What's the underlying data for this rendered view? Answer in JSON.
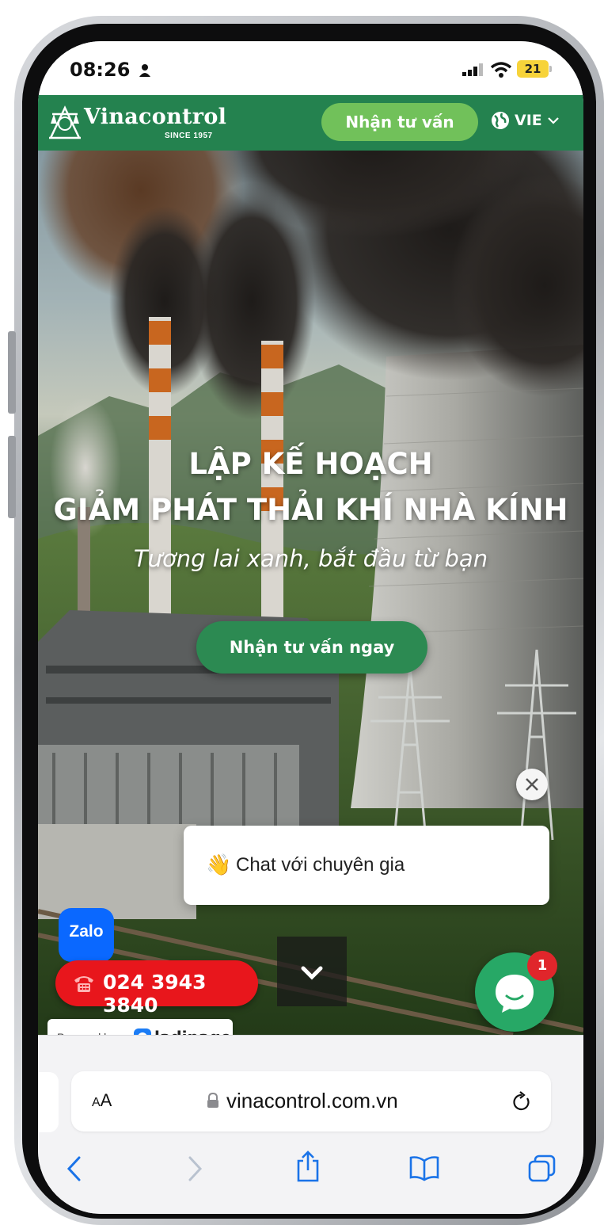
{
  "status_bar": {
    "time": "08:26",
    "battery": "21"
  },
  "header": {
    "brand": "Vinacontrol",
    "since": "SINCE 1957",
    "cta_label": "Nhận tư vấn",
    "language": "VIE"
  },
  "hero": {
    "title_line1": "LẬP KẾ HOẠCH",
    "title_line2": "GIẢM PHÁT THẢI KHÍ NHÀ KÍNH",
    "subtitle": "Tương lai xanh, bắt đầu từ bạn",
    "cta_label": "Nhận tư vấn ngay"
  },
  "chat": {
    "wave_emoji": "👋",
    "prompt": "Chat với chuyên gia",
    "unread_count": "1"
  },
  "contact": {
    "zalo_label": "Zalo",
    "phone": "024 3943 3840"
  },
  "footer_badge": {
    "powered_by": "Powered by",
    "brand": "ladipage"
  },
  "browser": {
    "aa_label_small": "A",
    "aa_label_large": "A",
    "url": "vinacontrol.com.vn"
  },
  "colors": {
    "brand_green": "#24824f",
    "light_green": "#71c15a",
    "phone_red": "#e8161c",
    "chat_green": "#27a866",
    "zalo_blue": "#0a68ff",
    "ios_blue": "#1a73e8"
  }
}
